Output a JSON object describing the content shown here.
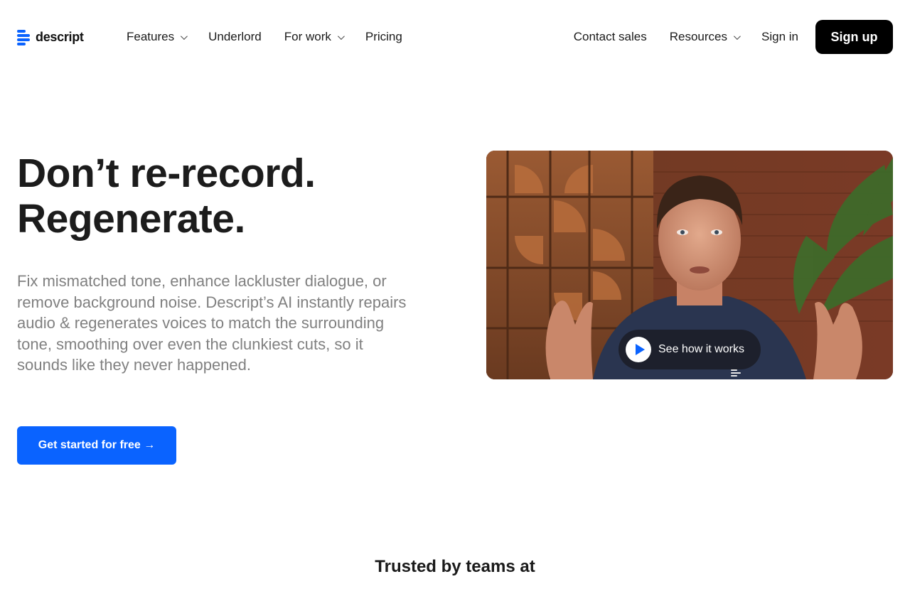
{
  "brand": {
    "name": "descript",
    "accent": "#0a63ff"
  },
  "nav": {
    "left_items": [
      {
        "label": "Features",
        "dropdown": true
      },
      {
        "label": "Underlord",
        "dropdown": false
      },
      {
        "label": "For work",
        "dropdown": true
      },
      {
        "label": "Pricing",
        "dropdown": false
      }
    ],
    "contact_sales": "Contact sales",
    "resources": "Resources",
    "sign_in": "Sign in",
    "sign_up": "Sign up"
  },
  "hero": {
    "title_line1": "Don’t re-record.",
    "title_line2": "Regenerate.",
    "description": "Fix mismatched tone, enhance lackluster dialogue, or remove background noise. Descript’s AI instantly repairs audio & regenerates voices to match the surrounding tone, smoothing over even the clunkiest cuts, so it sounds like they never happened.",
    "cta_label": "Get started for free →"
  },
  "video": {
    "watch_label": "See how it works",
    "play_icon": "play-icon"
  },
  "trusted": {
    "heading": "Trusted by teams at"
  }
}
